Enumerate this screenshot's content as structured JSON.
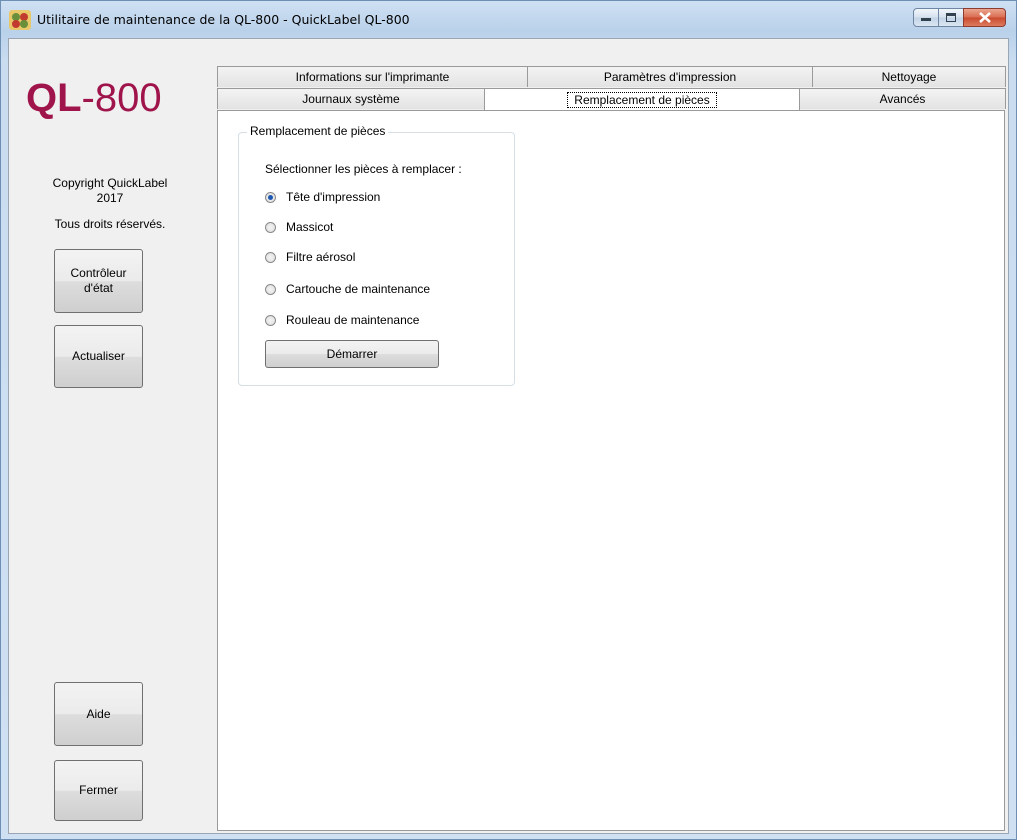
{
  "window": {
    "title": "Utilitaire de maintenance de la QL-800 - QuickLabel QL-800",
    "minimize_icon": "minimize-icon",
    "maximize_icon": "maximize-icon",
    "close_icon": "close-icon",
    "app_icon": "quicklabel-app-icon"
  },
  "sidebar": {
    "logo_bold": "QL",
    "logo_rest": "-800",
    "copyright_line1": "Copyright QuickLabel",
    "copyright_line2": "2017",
    "rights": "Tous droits réservés.",
    "status_button_line1": "Contrôleur",
    "status_button_line2": "d'état",
    "refresh_button": "Actualiser",
    "help_button": "Aide",
    "close_button": "Fermer"
  },
  "tabs": {
    "row1": [
      "Informations sur l'imprimante",
      "Paramètres d'impression",
      "Nettoyage"
    ],
    "row2": [
      "Journaux système",
      "Remplacement de pièces",
      "Avancés"
    ],
    "active": "Remplacement de pièces"
  },
  "parts": {
    "group_title": "Remplacement de pièces",
    "prompt": "Sélectionner les pièces à remplacer :",
    "options": [
      "Tête d'impression",
      "Massicot",
      "Filtre aérosol",
      "Cartouche de maintenance",
      "Rouleau de maintenance"
    ],
    "selected": "Tête d'impression",
    "start_button": "Démarrer"
  },
  "colors": {
    "logo": "#a0144c",
    "radio_selected": "#1e58b0",
    "title_bar": "#cfe0f3",
    "close_button": "#c8492d"
  }
}
